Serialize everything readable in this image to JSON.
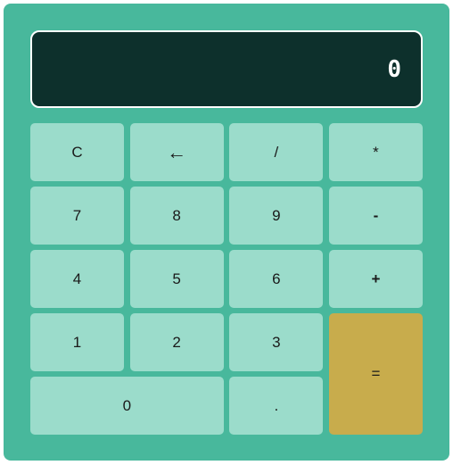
{
  "display": {
    "value": "0"
  },
  "keys": {
    "clear": "C",
    "backspace": "←",
    "divide": "/",
    "multiply": "*",
    "seven": "7",
    "eight": "8",
    "nine": "9",
    "subtract": "-",
    "four": "4",
    "five": "5",
    "six": "6",
    "add": "+",
    "one": "1",
    "two": "2",
    "three": "3",
    "equals": "=",
    "zero": "0",
    "decimal": "."
  },
  "colors": {
    "body": "#48b89c",
    "display_bg": "#0d302c",
    "key": "#9bdccb",
    "equals_key": "#c8ac4c"
  }
}
